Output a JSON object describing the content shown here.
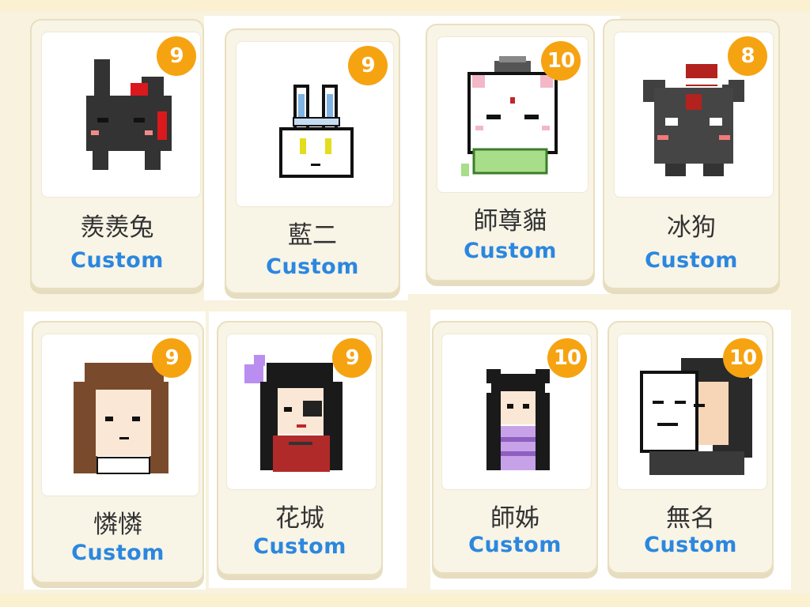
{
  "colors": {
    "background": "#f8f2de",
    "card": "#f8f4e6",
    "badge": "#f6a312",
    "custom_text": "#2b87df",
    "name_text": "#333333"
  },
  "characters": [
    {
      "name": "羨羨兔",
      "level": "9",
      "tag": "Custom",
      "avatar_icon": "black-bunny-icon"
    },
    {
      "name": "藍二",
      "level": "9",
      "tag": "Custom",
      "avatar_icon": "white-bunny-icon"
    },
    {
      "name": "師尊貓",
      "level": "10",
      "tag": "Custom",
      "avatar_icon": "white-cat-icon"
    },
    {
      "name": "冰狗",
      "level": "8",
      "tag": "Custom",
      "avatar_icon": "dark-dog-icon"
    },
    {
      "name": "憐憐",
      "level": "9",
      "tag": "Custom",
      "avatar_icon": "brown-hair-person-icon"
    },
    {
      "name": "花城",
      "level": "9",
      "tag": "Custom",
      "avatar_icon": "red-robe-person-icon"
    },
    {
      "name": "師姊",
      "level": "10",
      "tag": "Custom",
      "avatar_icon": "purple-dress-person-icon"
    },
    {
      "name": "無名",
      "level": "10",
      "tag": "Custom",
      "avatar_icon": "masked-person-icon"
    }
  ]
}
